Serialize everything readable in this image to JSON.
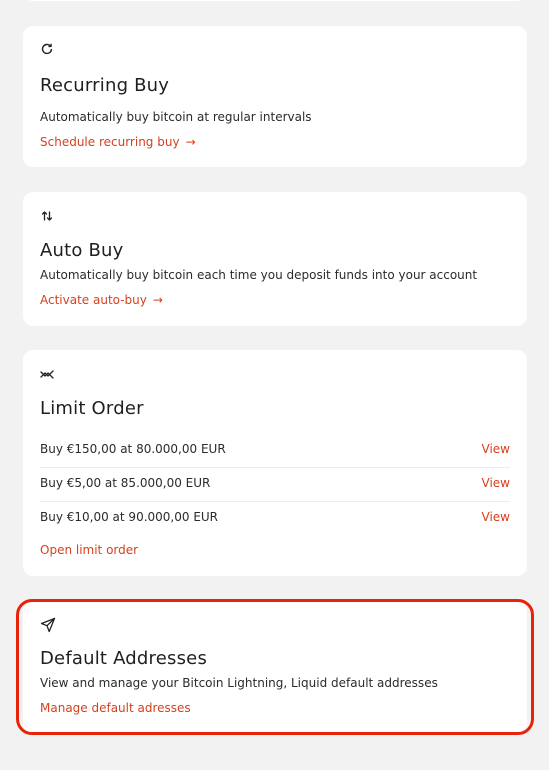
{
  "recurring_buy": {
    "icon": "refresh-icon",
    "title": "Recurring Buy",
    "description": "Automatically buy bitcoin at regular intervals",
    "link": "Schedule recurring buy",
    "link_arrow": "→"
  },
  "auto_buy": {
    "icon": "swap-vertical-icon",
    "title": "Auto Buy",
    "description": "Automatically buy bitcoin each time you deposit funds into your account",
    "link": "Activate auto-buy",
    "link_arrow": "→"
  },
  "limit_order": {
    "icon": "trend-icon",
    "title": "Limit Order",
    "orders": [
      {
        "label": "Buy €150,00 at 80.000,00 EUR",
        "action": "View"
      },
      {
        "label": "Buy €5,00 at 85.000,00 EUR",
        "action": "View"
      },
      {
        "label": "Buy €10,00 at 90.000,00 EUR",
        "action": "View"
      }
    ],
    "link": "Open limit order"
  },
  "default_addresses": {
    "icon": "send-icon",
    "title": "Default Addresses",
    "description": "View and manage your Bitcoin Lightning, Liquid default addresses",
    "link": "Manage default adresses"
  },
  "colors": {
    "accent": "#d7401c",
    "highlight": "#e8230a",
    "background": "#f2f2f2",
    "card": "#ffffff"
  }
}
